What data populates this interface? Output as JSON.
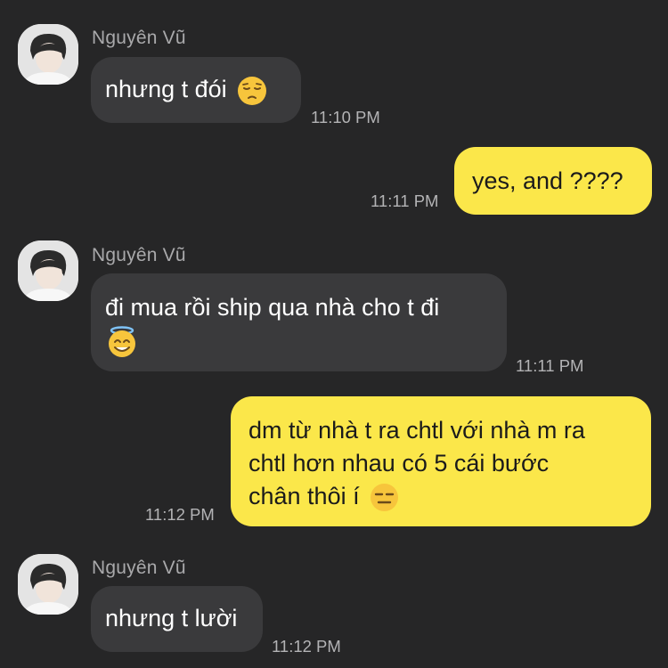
{
  "conversation": {
    "contact_name": "Nguyên Vũ",
    "messages": [
      {
        "direction": "incoming",
        "sender": "Nguyên Vũ",
        "text": "nhưng t đói",
        "emoji": "pensive-face",
        "time": "11:10 PM"
      },
      {
        "direction": "outgoing",
        "text": "yes, and ????",
        "time": "11:11 PM"
      },
      {
        "direction": "incoming",
        "sender": "Nguyên Vũ",
        "text": "đi mua rồi ship qua nhà cho t đi",
        "emoji": "smiling-face-with-halo",
        "time": "11:11 PM"
      },
      {
        "direction": "outgoing",
        "lines": [
          "dm từ nhà t ra chtl với nhà m ra",
          "chtl hơn nhau có 5 cái bước",
          "chân thôi í"
        ],
        "emoji": "expressionless-face",
        "time": "11:12 PM"
      },
      {
        "direction": "incoming",
        "sender": "Nguyên Vũ",
        "text": "nhưng t lười",
        "time": "11:12 PM"
      }
    ]
  },
  "colors": {
    "background": "#262627",
    "incoming_bubble": "#3a3a3c",
    "outgoing_bubble": "#fbe74a",
    "muted_text": "#a9a9ab"
  }
}
